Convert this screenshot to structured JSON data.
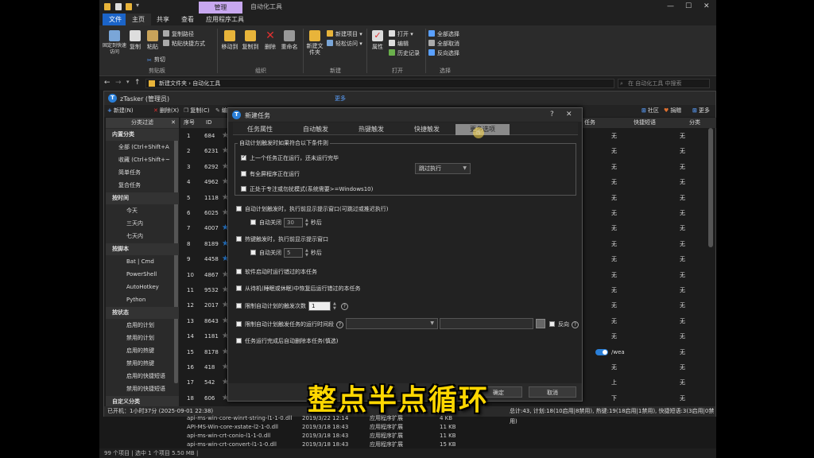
{
  "explorer": {
    "context_tab": "管理",
    "window_title": "自动化工具",
    "ribbon_tabs": [
      "文件",
      "主页",
      "共享",
      "查看",
      "应用程序工具"
    ],
    "ribbon": {
      "pin_quick": "固定到快速访问",
      "copy": "复制",
      "paste": "粘贴",
      "copy_path": "复制路径",
      "paste_shortcut": "粘贴快捷方式",
      "cut": "剪切",
      "move_to": "移动到",
      "copy_to": "复制到",
      "delete": "删除",
      "rename": "重命名",
      "new_folder": "新建文件夹",
      "new_item": "新建项目",
      "easy_access": "轻松访问",
      "properties": "属性",
      "open": "打开",
      "edit": "编辑",
      "history": "历史记录",
      "select_all": "全部选择",
      "select_none": "全部取消",
      "invert_selection": "反向选择",
      "groups": [
        "剪贴板",
        "组织",
        "新建",
        "打开",
        "选择"
      ]
    },
    "address": "新建文件夹  ›  自动化工具",
    "search_placeholder": "在 自动化工具 中搜索",
    "files": [
      {
        "name": "api-ms-win-core-winrt-string-l1-1-0.dll",
        "date": "2019/3/22 12:14",
        "type": "应用程序扩展",
        "size": "4 KB"
      },
      {
        "name": "API-MS-Win-core-xstate-l2-1-0.dll",
        "date": "2019/3/18 18:43",
        "type": "应用程序扩展",
        "size": "11 KB"
      },
      {
        "name": "api-ms-win-crt-conio-l1-1-0.dll",
        "date": "2019/3/18 18:43",
        "type": "应用程序扩展",
        "size": "11 KB"
      },
      {
        "name": "api-ms-win-crt-convert-l1-1-0.dll",
        "date": "2019/3/18 18:43",
        "type": "应用程序扩展",
        "size": "15 KB"
      }
    ],
    "status": "99 个项目  |  选中 1 个项目  5.50 MB  |"
  },
  "ztasker": {
    "title": "zTasker (管理员)",
    "more": "更多",
    "toolbar": {
      "new": "新建(N)",
      "delete": "删除(X)",
      "copy": "复制(C)",
      "edit": "编",
      "community": "社区",
      "donate": "捐赠",
      "more": "更多"
    },
    "sidebar": {
      "header": "分类过滤",
      "items": [
        {
          "label": "内置分类",
          "kind": "sec"
        },
        {
          "label": "全部 (Ctrl+Shift+A",
          "kind": "item"
        },
        {
          "label": "收藏 (Ctrl+Shift+~",
          "kind": "item"
        },
        {
          "label": "简单任务",
          "kind": "item"
        },
        {
          "label": "复合任务",
          "kind": "item"
        },
        {
          "label": "按时间",
          "kind": "sec"
        },
        {
          "label": "今天",
          "kind": "item2"
        },
        {
          "label": "三天内",
          "kind": "item2"
        },
        {
          "label": "七天内",
          "kind": "item2"
        },
        {
          "label": "按脚本",
          "kind": "sec"
        },
        {
          "label": "Bat | Cmd",
          "kind": "item2"
        },
        {
          "label": "PowerShell",
          "kind": "item2"
        },
        {
          "label": "AutoHotkey",
          "kind": "item2"
        },
        {
          "label": "Python",
          "kind": "item2"
        },
        {
          "label": "按状态",
          "kind": "sec"
        },
        {
          "label": "启用的计划",
          "kind": "item2"
        },
        {
          "label": "禁用的计划",
          "kind": "item2"
        },
        {
          "label": "启用的热键",
          "kind": "item2"
        },
        {
          "label": "禁用的热键",
          "kind": "item2"
        },
        {
          "label": "启用的快捷短语",
          "kind": "item2"
        },
        {
          "label": "禁用的快捷短语",
          "kind": "item2"
        },
        {
          "label": "自定义分类",
          "kind": "sec"
        }
      ]
    },
    "columns": {
      "seq": "序号",
      "id": "ID",
      "task_suffix": "任务",
      "shortcut": "快捷短语",
      "category": "分类"
    },
    "rows": [
      {
        "seq": "1",
        "id": "684",
        "fav": false,
        "shortcut": "无",
        "cat": "无"
      },
      {
        "seq": "2",
        "id": "6231",
        "fav": false,
        "shortcut": "无",
        "cat": "无"
      },
      {
        "seq": "3",
        "id": "6292",
        "fav": false,
        "shortcut": "无",
        "cat": "无"
      },
      {
        "seq": "4",
        "id": "4962",
        "fav": false,
        "shortcut": "无",
        "cat": "无"
      },
      {
        "seq": "5",
        "id": "1118",
        "fav": false,
        "shortcut": "无",
        "cat": "无"
      },
      {
        "seq": "6",
        "id": "6025",
        "fav": false,
        "shortcut": "无",
        "cat": "无"
      },
      {
        "seq": "7",
        "id": "4007",
        "fav": true,
        "shortcut": "无",
        "cat": "无"
      },
      {
        "seq": "8",
        "id": "8189",
        "fav": true,
        "shortcut": "无",
        "cat": "无"
      },
      {
        "seq": "9",
        "id": "4458",
        "fav": true,
        "shortcut": "无",
        "cat": "无"
      },
      {
        "seq": "10",
        "id": "4867",
        "fav": false,
        "shortcut": "无",
        "cat": "无"
      },
      {
        "seq": "11",
        "id": "9532",
        "fav": false,
        "shortcut": "无",
        "cat": "无"
      },
      {
        "seq": "12",
        "id": "2017",
        "fav": false,
        "shortcut": "无",
        "cat": "无"
      },
      {
        "seq": "13",
        "id": "8643",
        "fav": false,
        "shortcut": "无",
        "cat": "无"
      },
      {
        "seq": "14",
        "id": "1181",
        "fav": false,
        "shortcut": "无",
        "cat": "无"
      },
      {
        "seq": "15",
        "id": "8178",
        "fav": false,
        "shortcut": "/wea",
        "cat": "无"
      },
      {
        "seq": "16",
        "id": "418",
        "fav": false,
        "shortcut": "无",
        "cat": "无"
      },
      {
        "seq": "17",
        "id": "542",
        "fav": false,
        "shortcut": "上",
        "cat": "无"
      },
      {
        "seq": "18",
        "id": "606",
        "fav": false,
        "shortcut": "下",
        "cat": "无"
      }
    ],
    "status_left": "已开机：1小时37分 (2025-09-01 22:38)",
    "status_right": "总计:43, 计划:18(10启用|8禁用), 热键:19(18启用|1禁用), 快捷短语:3(3启用|0禁用)"
  },
  "dialog": {
    "title": "新建任务",
    "tabs": [
      "任务属性",
      "自动触发",
      "热键触发",
      "快捷触发",
      "更多选项"
    ],
    "group_legend": "自动计划触发时如果符合以下条件则",
    "opt_running": "上一个任务正在运行，还未运行完毕",
    "opt_fullscreen": "有全屏程序正在运行",
    "opt_focus": "正处于专注或勿扰模式(系统需要>=Windows10)",
    "skip_dropdown": "跳过执行",
    "opt_prompt_auto": "自动计划触发时，执行前显示提示窗口(可跳过或推迟执行)",
    "auto_close": "自动关闭",
    "auto_close_sec_1": "30",
    "seconds": "秒后",
    "opt_prompt_hotkey": "热键触发时，执行前显示提示窗口",
    "auto_close_sec_2": "5",
    "opt_run_missed": "软件启动时运行错过的本任务",
    "opt_resume": "从待机(睡眠或休眠)中恢复后运行错过的本任务",
    "opt_limit_count": "限制自动计划的触发次数",
    "limit_count_value": "1",
    "opt_limit_time": "限制自动计划触发任务的运行时间段",
    "reverse": "反向",
    "opt_delete_after": "任务运行完成后自动删除本任务(慎选)",
    "ok": "确定",
    "cancel": "取消"
  },
  "subtitle": "整点半点循环"
}
